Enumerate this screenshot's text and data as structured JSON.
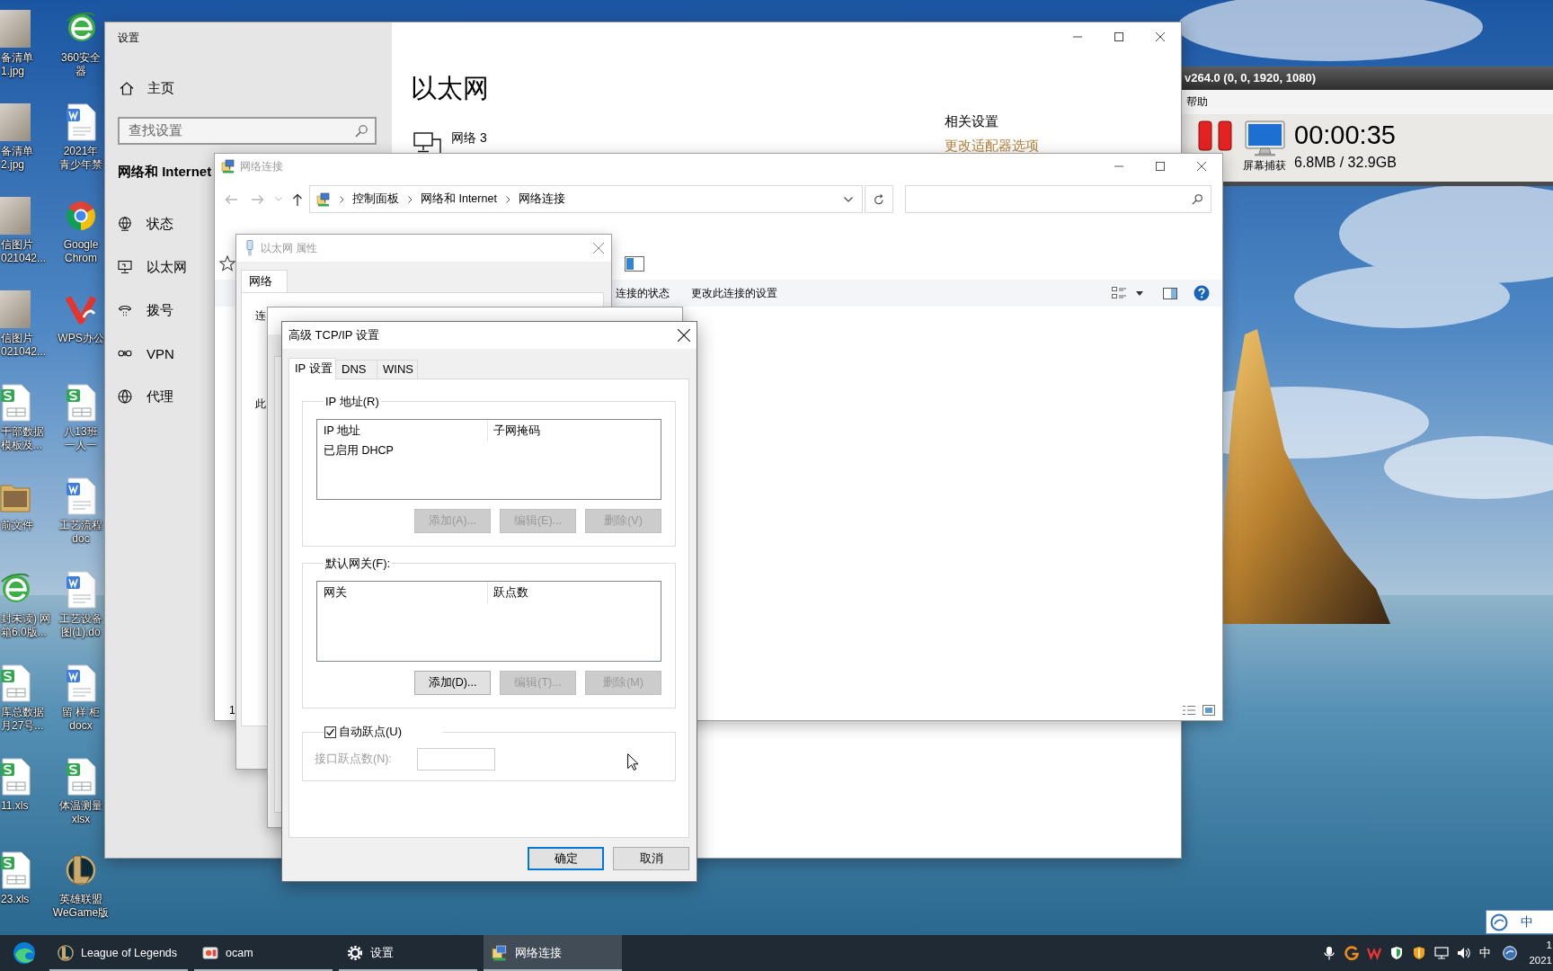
{
  "desktop": {
    "columns": [
      {
        "icons": [
          {
            "kind": "photo",
            "label": [
              "备清单",
              "1.jpg"
            ]
          },
          {
            "kind": "photo",
            "label": [
              "备清单",
              "2.jpg"
            ]
          },
          {
            "kind": "photo",
            "label": [
              "信图片",
              "021042..."
            ]
          },
          {
            "kind": "photo",
            "label": [
              "信图片",
              "021042..."
            ]
          },
          {
            "kind": "sheet",
            "label": [
              "干部数据",
              "模板及..."
            ]
          },
          {
            "kind": "folder",
            "label": [
              "前文件"
            ]
          },
          {
            "kind": "swoosh",
            "label": [
              "封未读) 网",
              "箱6.0版..."
            ]
          },
          {
            "kind": "sheet",
            "label": [
              "库总数据",
              "月27号..."
            ]
          },
          {
            "kind": "sheet",
            "label": [
              "11.xls"
            ]
          },
          {
            "kind": "sheet",
            "label": [
              "23.xls"
            ]
          }
        ]
      },
      {
        "icons": [
          {
            "kind": "swoosh",
            "label": [
              "360安全",
              "器"
            ]
          },
          {
            "kind": "doc",
            "label": [
              "2021年",
              "青少年禁"
            ]
          },
          {
            "kind": "ring",
            "label": [
              "Google",
              "Chrom"
            ]
          },
          {
            "kind": "vlogo",
            "label": [
              "WPS办公"
            ]
          },
          {
            "kind": "sheet",
            "label": [
              "八13班",
              "一人一"
            ]
          },
          {
            "kind": "doc",
            "label": [
              "工艺流程",
              "doc"
            ]
          },
          {
            "kind": "doc",
            "label": [
              "工艺设备",
              "图(1).do"
            ]
          },
          {
            "kind": "doc",
            "label": [
              "留 样 柜",
              "docx"
            ]
          },
          {
            "kind": "sheet",
            "label": [
              "体温测量",
              "xlsx"
            ]
          },
          {
            "kind": "crest",
            "label": [
              "英雄联盟",
              "WeGame版"
            ]
          }
        ]
      }
    ]
  },
  "settings_window": {
    "title": "设置",
    "home": "主页",
    "search": {
      "placeholder": "查找设置"
    },
    "section": "网络和 Internet",
    "nav": [
      "状态",
      "以太网",
      "拨号",
      "VPN",
      "代理"
    ],
    "heading": "以太网",
    "network": {
      "name": "网络 3"
    },
    "related": {
      "title": "相关设置",
      "link": "更改适配器选项"
    }
  },
  "ocam_window": {
    "title": "v264.0 (0, 0, 1920, 1080)",
    "menu": [
      "帮助"
    ],
    "capture_label": "屏幕捕获",
    "timer": "00:00:35",
    "storage": "6.8MB / 32.9GB"
  },
  "network_window": {
    "title": "网络连接",
    "breadcrumb": [
      "控制面板",
      "网络和 Internet",
      "网络连接"
    ],
    "commands": [
      "连接的状态",
      "更改此连接的设置"
    ],
    "status": "1"
  },
  "ethernet_dialog": {
    "title": "以太网 属性",
    "tabs": [
      {
        "label": "网络",
        "selected": true
      }
    ],
    "cut_texts": [
      "连",
      "此"
    ]
  },
  "advanced_dialog": {
    "title": "高级 TCP/IP 设置",
    "tabs": [
      {
        "label": "IP 设置",
        "selected": true
      },
      {
        "label": "DNS",
        "selected": false
      },
      {
        "label": "WINS",
        "selected": false
      }
    ],
    "groups": [
      {
        "title": "IP 地址(R)",
        "columns": [
          "IP 地址",
          "子网掩码"
        ],
        "rows": [
          [
            "已启用 DHCP"
          ]
        ],
        "buttons": [
          {
            "label": "添加(A)...",
            "disabled": true
          },
          {
            "label": "编辑(E)...",
            "disabled": true
          },
          {
            "label": "删除(V)",
            "disabled": true
          }
        ]
      },
      {
        "title": "默认网关(F):",
        "columns": [
          "网关",
          "跃点数"
        ],
        "buttons": [
          {
            "label": "添加(D)...",
            "disabled": false
          },
          {
            "label": "编辑(T)...",
            "disabled": true
          },
          {
            "label": "删除(M)",
            "disabled": true
          }
        ]
      }
    ],
    "auto_metric": {
      "label": "自动跃点(U)",
      "checked": true
    },
    "metric": {
      "label": "接口跃点数(N):",
      "disabled": true
    },
    "buttons": [
      {
        "label": "确定",
        "default": true
      },
      {
        "label": "取消",
        "default": false
      }
    ]
  },
  "ime_bar": {
    "mode": "中"
  },
  "taskbar": {
    "items": [
      {
        "label": "League of Legends",
        "selected": false
      },
      {
        "label": "ocam",
        "selected": false
      },
      {
        "label": "设置",
        "selected": false
      },
      {
        "label": "网络连接",
        "selected": true
      }
    ],
    "tray": {
      "ime": "中",
      "clock": {
        "time": "1",
        "date": "2021"
      }
    }
  }
}
